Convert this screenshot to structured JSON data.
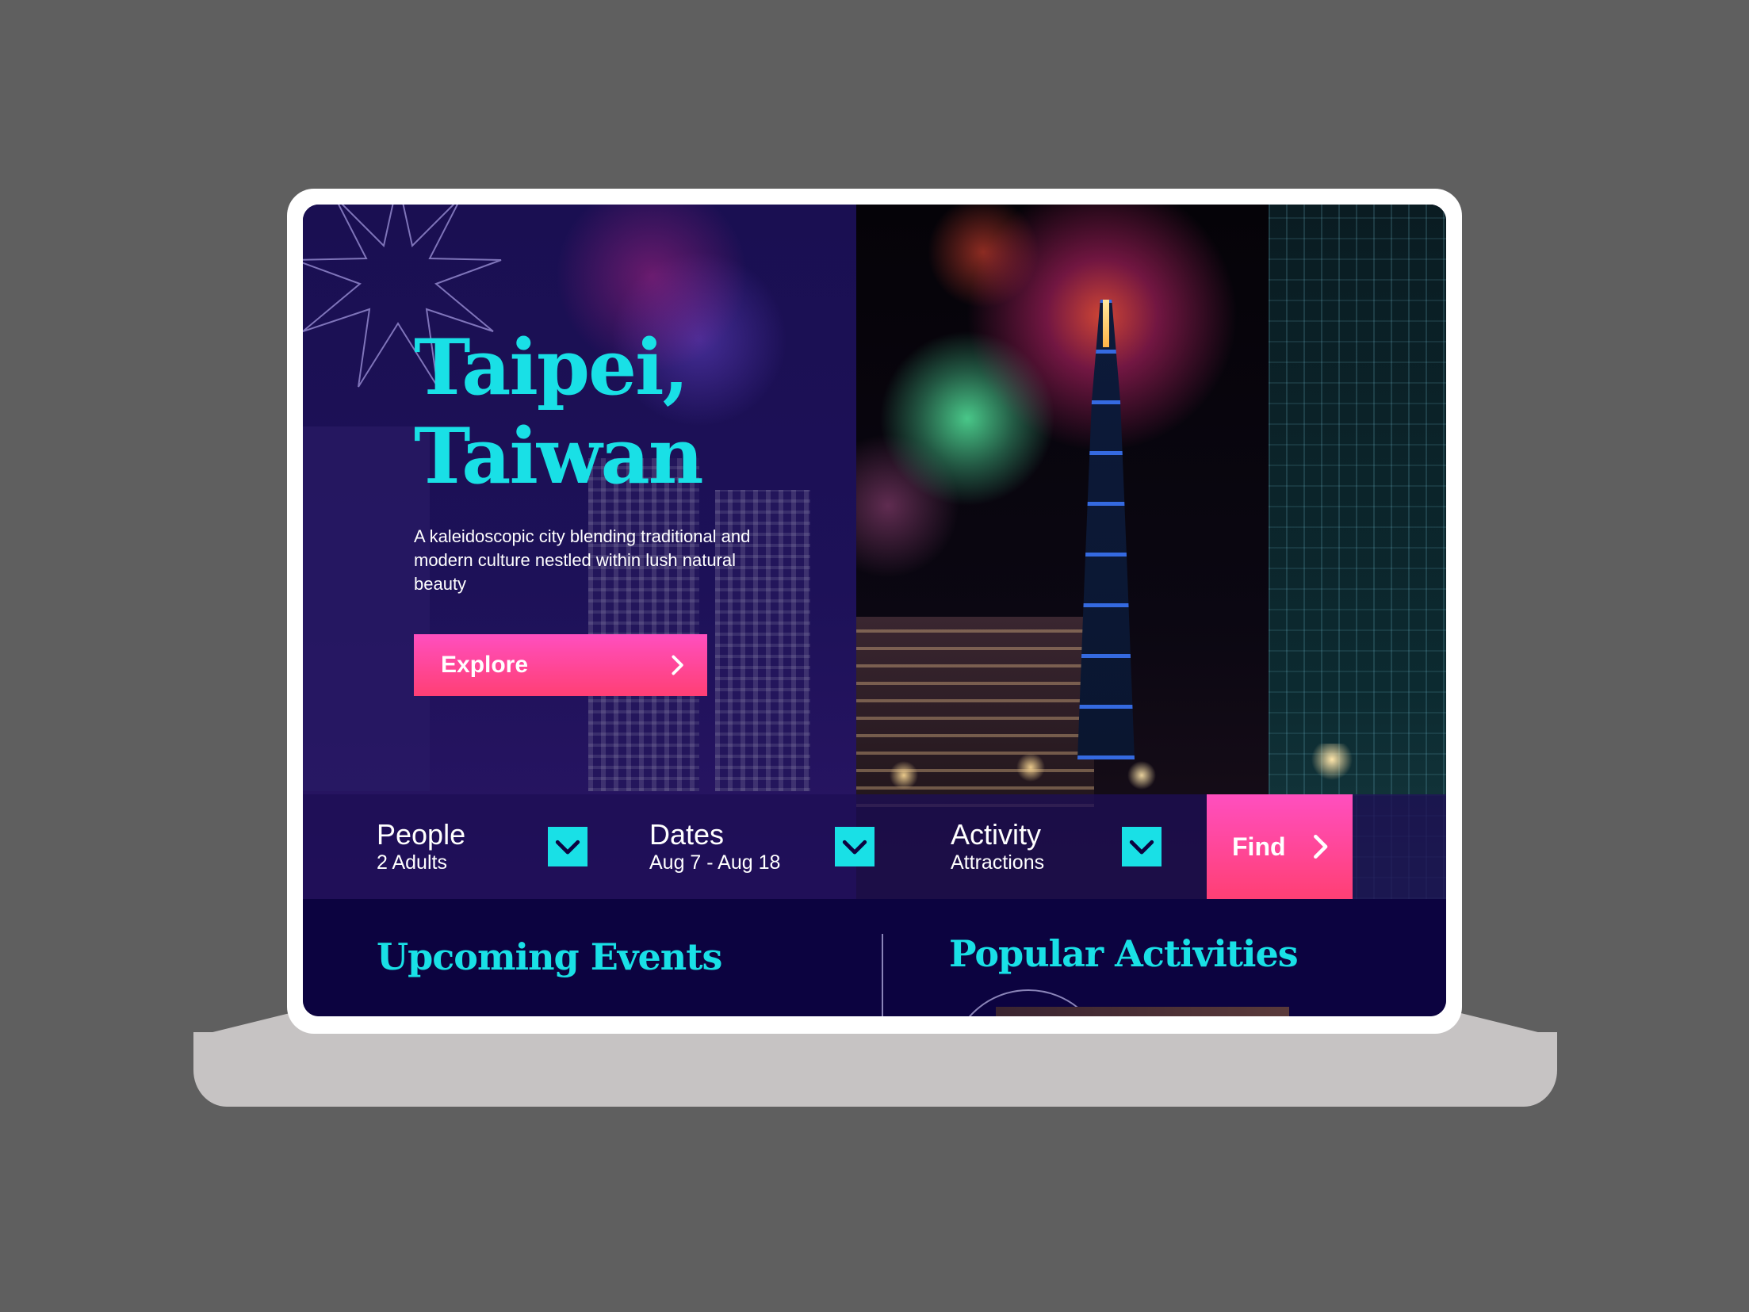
{
  "hero": {
    "title_line1": "Taipei,",
    "title_line2": "Taiwan",
    "tagline": "A kaleidoscopic city blending traditional and modern culture nestled within lush natural beauty",
    "explore_label": "Explore"
  },
  "search": {
    "people": {
      "label": "People",
      "value": "2 Adults"
    },
    "dates": {
      "label": "Dates",
      "value": "Aug 7 - Aug 18"
    },
    "activity": {
      "label": "Activity",
      "value": "Attractions"
    },
    "find_label": "Find"
  },
  "sections": {
    "upcoming_events": "Upcoming Events",
    "popular_activities": "Popular Activities"
  },
  "colors": {
    "accent": "#19e0e6",
    "button_top": "#ff4fbf",
    "button_bottom": "#ff3f74",
    "background": "#0c0340",
    "desk": "#5f5f5f"
  },
  "icons": {
    "explore": "chevron-right-icon",
    "find": "chevron-right-icon",
    "dropdown": "chevron-down-icon",
    "decor": "star-outline-icon"
  }
}
